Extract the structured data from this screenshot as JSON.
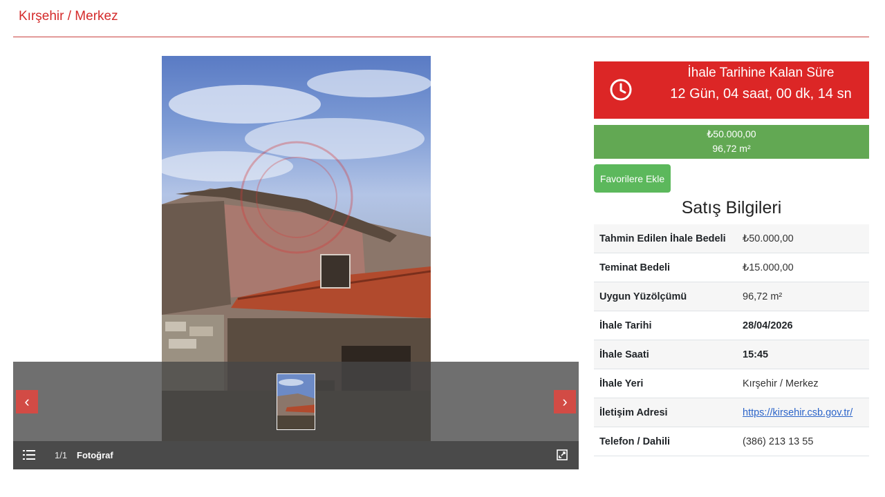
{
  "header": {
    "title": "Kırşehir / Merkez"
  },
  "gallery": {
    "counter": "1/1",
    "label": "Fotoğraf",
    "prev_label": "‹",
    "next_label": "›",
    "icons": [
      "list-icon",
      "fullscreen-icon",
      "chevron-left-icon",
      "chevron-right-icon"
    ]
  },
  "countdown": {
    "title": "İhale Tarihine Kalan Süre",
    "time": "12 Gün, 04 saat, 00 dk, 14 sn",
    "icon": "clock-icon",
    "color": "#dc2626"
  },
  "price_box": {
    "price": "₺50.000,00",
    "area": "96,72 m²",
    "color": "#62a853"
  },
  "favorites_label": "Favorilere Ekle",
  "sale_info": {
    "title": "Satış Bilgileri",
    "rows": [
      {
        "label": "Tahmin Edilen İhale Bedeli",
        "value": "₺50.000,00"
      },
      {
        "label": "Teminat Bedeli",
        "value": "₺15.000,00"
      },
      {
        "label": "Uygun Yüzölçümü",
        "value": "96,72 m²"
      },
      {
        "label": "İhale Tarihi",
        "value": "28/04/2026"
      },
      {
        "label": "İhale Saati",
        "value": "15:45"
      },
      {
        "label": "İhale Yeri",
        "value": "Kırşehir / Merkez"
      },
      {
        "label": "İletişim Adresi",
        "value": "https://kirsehir.csb.gov.tr/"
      },
      {
        "label": "Telefon / Dahili",
        "value": "(386) 213 13 55"
      }
    ]
  }
}
